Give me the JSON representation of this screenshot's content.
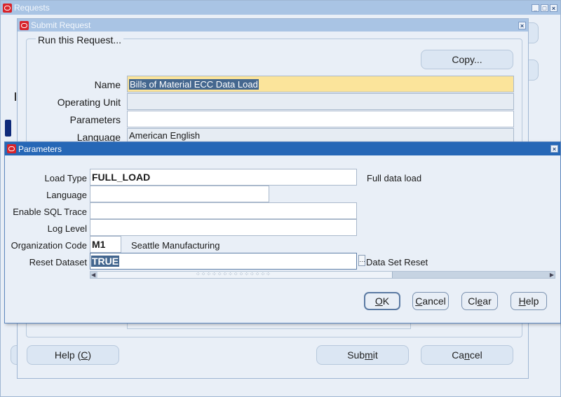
{
  "requests_window": {
    "title": "Requests"
  },
  "submit_window": {
    "title": "Submit Request",
    "section_label": "Run this Request...",
    "copy_button": "Copy...",
    "fields": {
      "name_label": "Name",
      "name_value": "Bills of Material ECC Data Load",
      "operating_unit_label": "Operating Unit",
      "operating_unit_value": "",
      "parameters_label": "Parameters",
      "parameters_value": "",
      "language_label": "Language",
      "language_value": "American English"
    },
    "help_button": {
      "text": "Help (",
      "key": "C",
      "close": ")"
    },
    "submit_button": {
      "pre": "Sub",
      "key": "m",
      "post": "it"
    },
    "cancel_button": {
      "pre": "Ca",
      "key": "n",
      "post": "cel"
    }
  },
  "parameters_window": {
    "title": "Parameters",
    "rows": {
      "load_type": {
        "label": "Load Type",
        "value": "FULL_LOAD",
        "description": "Full data load"
      },
      "language": {
        "label": "Language",
        "value": ""
      },
      "sql_trace": {
        "label": "Enable SQL Trace",
        "value": ""
      },
      "log_level": {
        "label": "Log Level",
        "value": ""
      },
      "org_code": {
        "label": "Organization Code",
        "value": "M1",
        "description": "Seattle Manufacturing"
      },
      "reset_dataset": {
        "label": "Reset Dataset",
        "value": "TRUE",
        "description": "Data Set Reset"
      }
    },
    "buttons": {
      "ok": {
        "key": "O",
        "post": "K"
      },
      "cancel": {
        "key": "C",
        "post": "ancel"
      },
      "clear": {
        "pre": "Cl",
        "key": "e",
        "post": "ar"
      },
      "help": {
        "key": "H",
        "post": "elp"
      }
    }
  },
  "colors": {
    "titlebar_active": "#2667b6",
    "titlebar_inactive": "#a9c4e4",
    "name_field_highlight": "#fbe49b",
    "selection": "#44678f"
  }
}
